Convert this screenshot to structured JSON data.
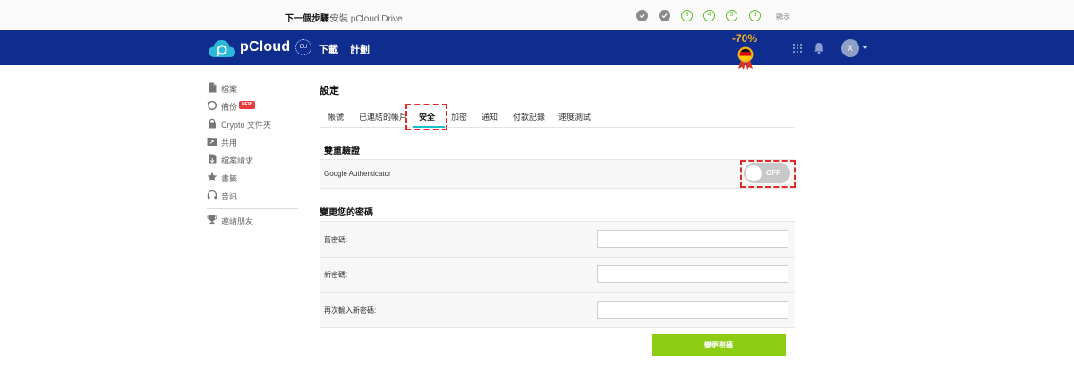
{
  "progress": {
    "next_label": "下一個步驟:",
    "next_task": "安裝 pCloud Drive",
    "steps": [
      {
        "label": "",
        "state": "done"
      },
      {
        "label": "",
        "state": "done"
      },
      {
        "label": "3",
        "state": "todo"
      },
      {
        "label": "4",
        "state": "todo"
      },
      {
        "label": "5",
        "state": "todo"
      },
      {
        "label": "6",
        "state": "todo"
      }
    ],
    "show_label": "顯示"
  },
  "header": {
    "brand": "pCloud",
    "eu_badge": "EU",
    "nav": [
      "下載",
      "計劃"
    ],
    "promo": "-70%",
    "avatar_initial": "X"
  },
  "sidebar": {
    "items": [
      {
        "label": "檔案",
        "icon": "file-icon"
      },
      {
        "label": "備份",
        "icon": "backup-icon",
        "badge": "NEW"
      },
      {
        "label": "Crypto 文件夾",
        "icon": "lock-icon"
      },
      {
        "label": "共用",
        "icon": "shared-folder-icon"
      },
      {
        "label": "檔案請求",
        "icon": "file-request-icon"
      },
      {
        "label": "書籤",
        "icon": "star-icon"
      },
      {
        "label": "音訊",
        "icon": "headphones-icon"
      },
      {
        "label": "邀請朋友",
        "icon": "trophy-icon"
      }
    ]
  },
  "settings": {
    "title": "設定",
    "tabs": [
      "帳號",
      "已連結的帳戶",
      "安全",
      "加密",
      "通知",
      "付款記錄",
      "速度測試"
    ],
    "active_tab": "安全",
    "two_factor": {
      "title": "雙重驗證",
      "authenticator_label": "Google Authenticator",
      "toggle_state": "OFF"
    },
    "password": {
      "title": "變更您的密碼",
      "old_label": "舊密碼:",
      "new_label": "新密碼:",
      "repeat_label": "再次輸入新密碼:",
      "submit_label": "變更密碼"
    }
  },
  "colors": {
    "header_bg": "#0e2d8e",
    "accent_green": "#8ccc12",
    "step_green": "#5dbb1f",
    "active_tab_underline": "#17bed0",
    "highlight_red": "#e12b2b",
    "promo_gold": "#f2b31c"
  }
}
